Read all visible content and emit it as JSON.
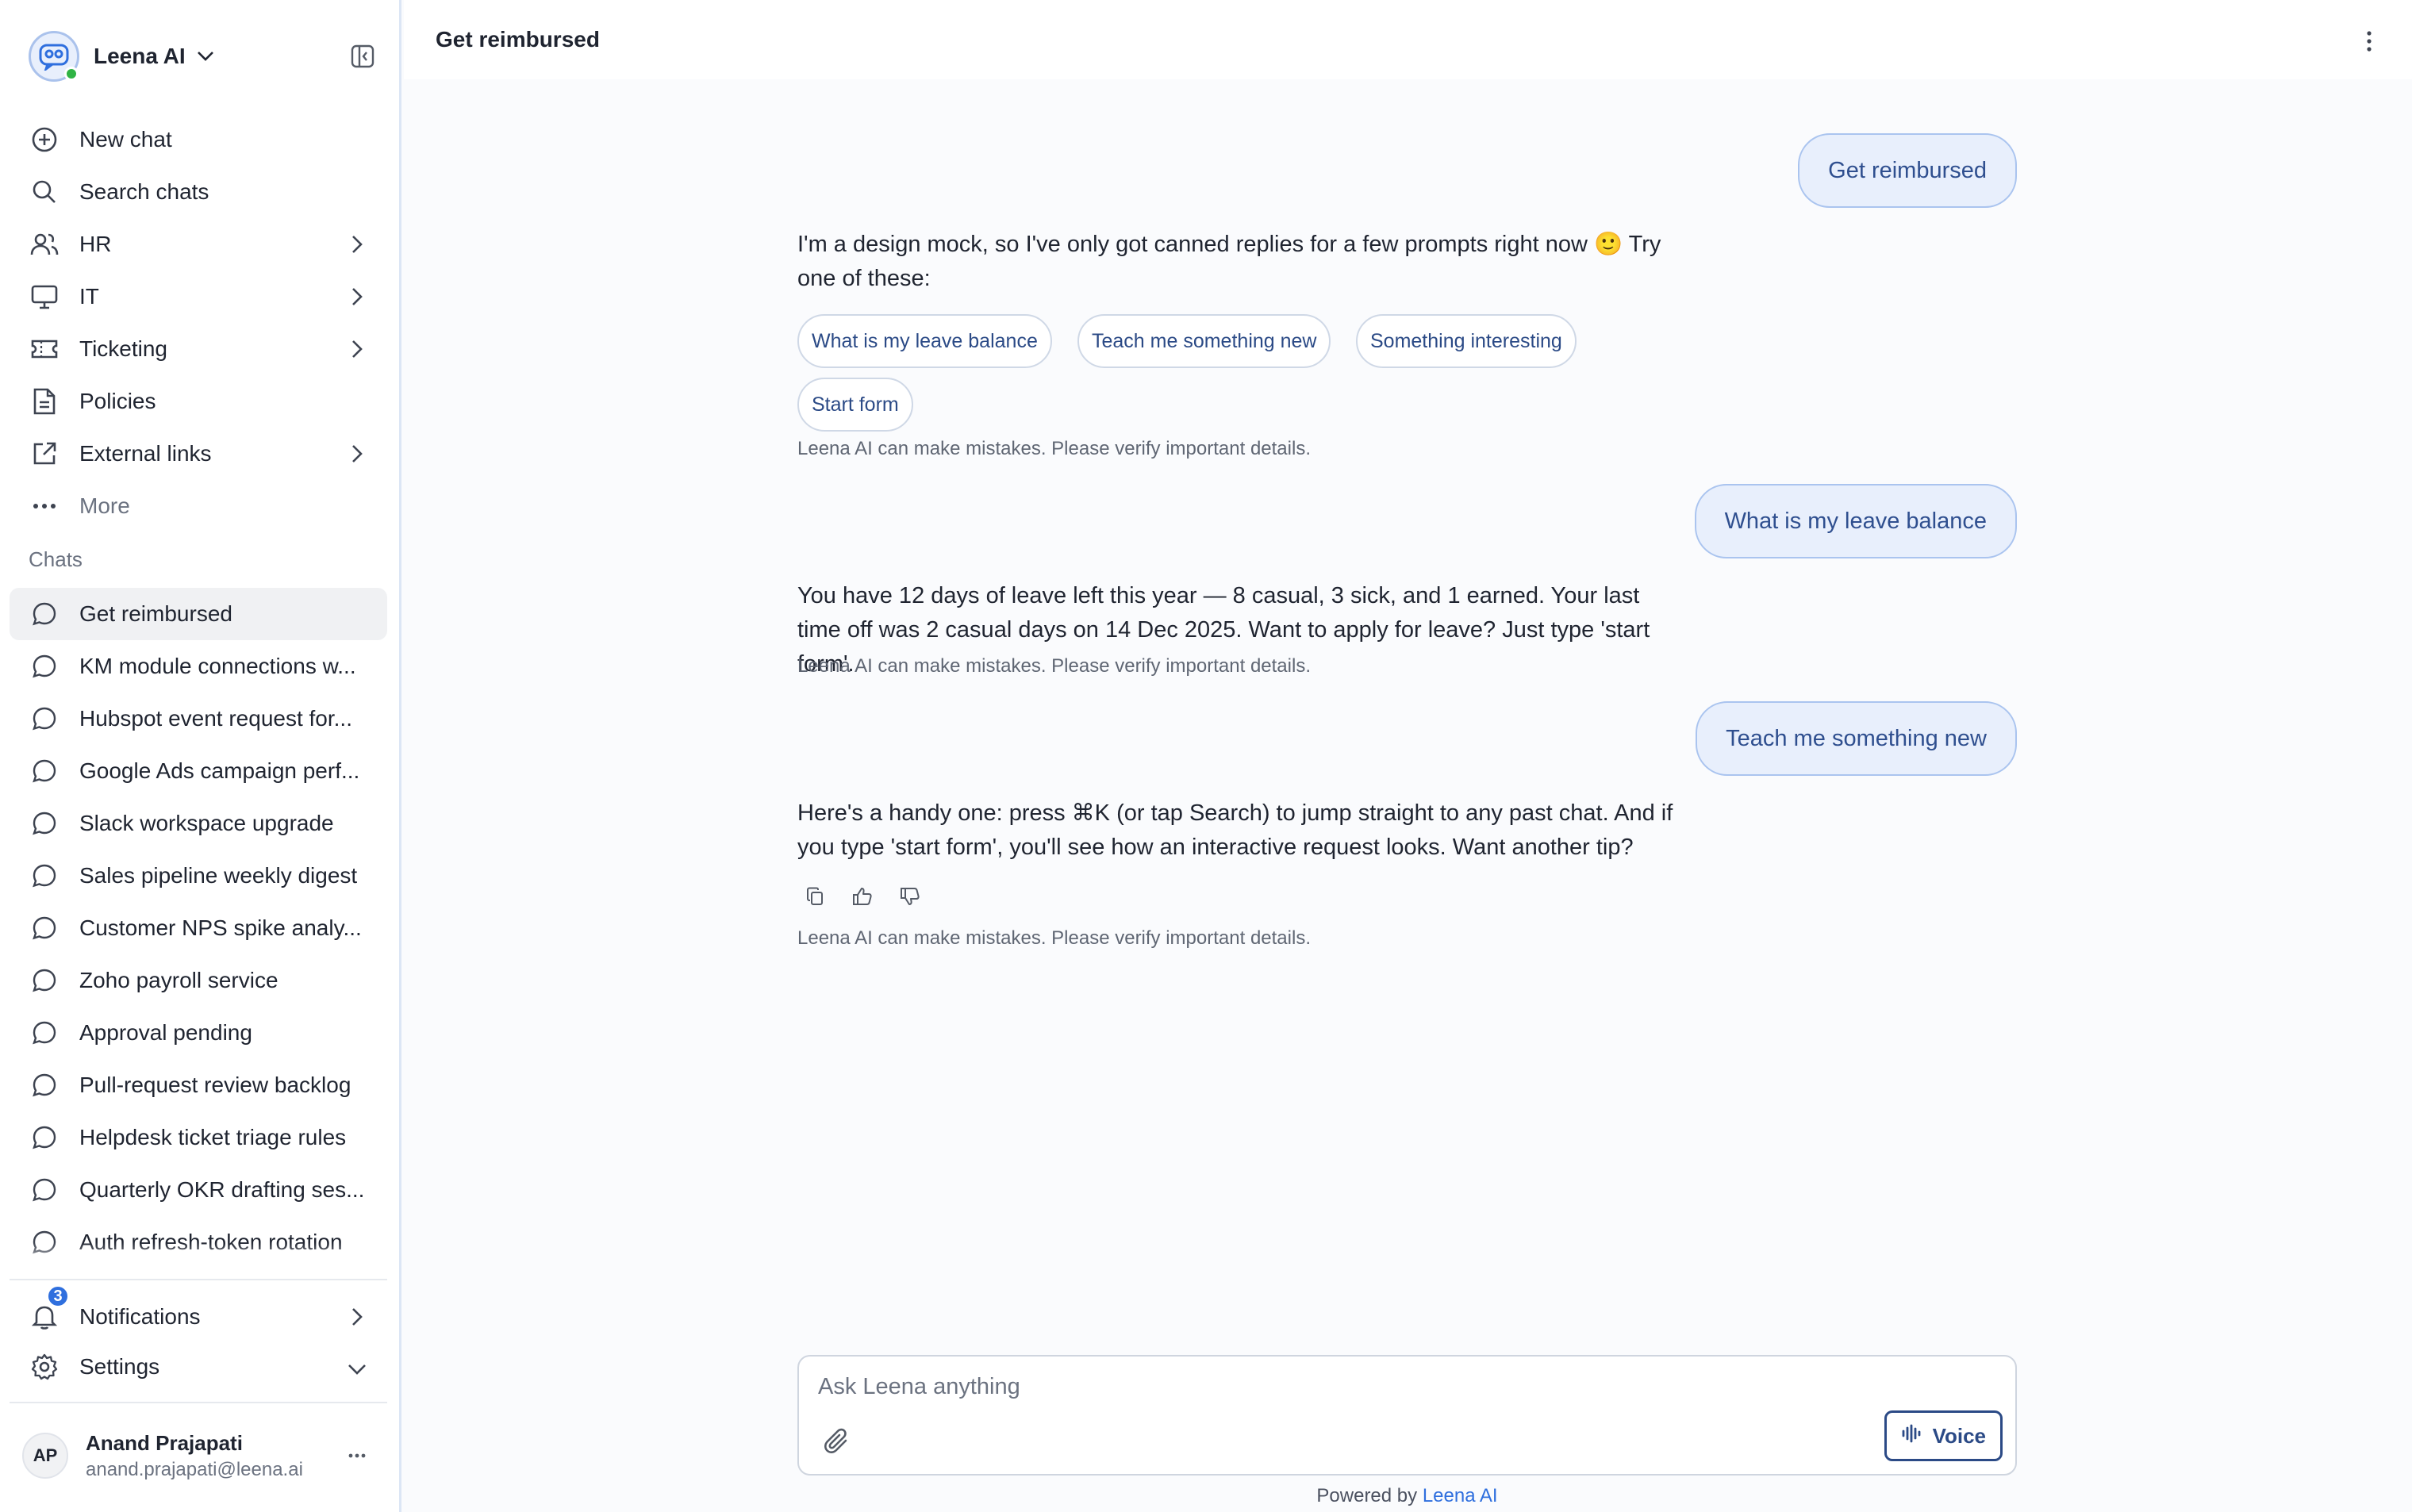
{
  "workspace": {
    "name": "Leena AI"
  },
  "nav": {
    "items": [
      {
        "label": "New chat",
        "icon": "plus-circle-icon"
      },
      {
        "label": "Search chats",
        "icon": "search-icon"
      },
      {
        "label": "HR",
        "icon": "users-icon"
      },
      {
        "label": "IT",
        "icon": "monitor-icon"
      },
      {
        "label": "Ticketing",
        "icon": "ticket-icon"
      },
      {
        "label": "Policies",
        "icon": "document-icon"
      },
      {
        "label": "External links",
        "icon": "external-link-icon"
      },
      {
        "label": "More",
        "icon": "more-horizontal-icon"
      }
    ]
  },
  "chats": {
    "title": "Chats",
    "items": [
      "Get reimbursed",
      "KM module connections w...",
      "Hubspot event request for...",
      "Google Ads campaign perf...",
      "Slack workspace upgrade",
      "Sales pipeline weekly digest",
      "Customer NPS spike analy...",
      "Zoho payroll service",
      "Approval pending",
      "Pull-request review backlog",
      "Helpdesk ticket triage rules",
      "Quarterly OKR drafting ses...",
      "Auth refresh-token rotation"
    ]
  },
  "bottom_nav": {
    "notifications": {
      "label": "Notifications",
      "badge": "3"
    },
    "settings": {
      "label": "Settings"
    }
  },
  "user": {
    "initials": "AP",
    "name": "Anand Prajapati",
    "email": "anand.prajapati@leena.ai"
  },
  "header": {
    "title": "Get reimbursed"
  },
  "conversation": {
    "user_messages": [
      "Get reimbursed",
      "What is my leave balance",
      "Teach me something new"
    ],
    "bot_messages": [
      "I'm a design mock, so I've only got canned replies for a few prompts right now 🙂 Try one of these:",
      "You have 12 days of leave left this year — 8 casual, 3 sick, and 1 earned. Your last time off was 2 casual days on 14 Dec 2025. Want to apply for leave? Just type 'start form'.",
      "Here's a handy one: press ⌘K (or tap Search) to jump straight to any past chat. And if you type 'start form', you'll see how an interactive request looks. Want another tip?"
    ],
    "suggestions": [
      "What is my leave balance",
      "Teach me something new",
      "Something interesting",
      "Start form"
    ],
    "disclaimer": "Leena AI can make mistakes. Please verify important details."
  },
  "composer": {
    "placeholder": "Ask Leena anything",
    "voice_label": "Voice"
  },
  "footer": {
    "powered_prefix": "Powered by",
    "brand": "Leena AI"
  },
  "colors": {
    "accent": "#2f6fde",
    "bubble_bg": "#e8effc",
    "bubble_border": "#aac4ef",
    "online": "#2fb344"
  }
}
